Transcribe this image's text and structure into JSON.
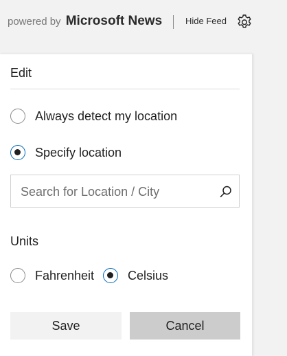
{
  "header": {
    "powered_by": "powered by",
    "brand": "Microsoft News",
    "hide_feed": "Hide Feed",
    "settings_icon": "gear-icon"
  },
  "edit_panel": {
    "title": "Edit",
    "location_options": [
      {
        "label": "Always detect my location",
        "selected": false
      },
      {
        "label": "Specify location",
        "selected": true
      }
    ],
    "search": {
      "placeholder": "Search for Location / City",
      "value": "",
      "icon": "search-icon"
    },
    "units": {
      "title": "Units",
      "options": [
        {
          "label": "Fahrenheit",
          "selected": false
        },
        {
          "label": "Celsius",
          "selected": true
        }
      ]
    },
    "save_label": "Save",
    "cancel_label": "Cancel"
  },
  "colors": {
    "accent": "#0067b8",
    "background": "#f2f2f2",
    "panel": "#ffffff",
    "cancel_button": "#cccccc",
    "save_button": "#f2f2f2"
  }
}
